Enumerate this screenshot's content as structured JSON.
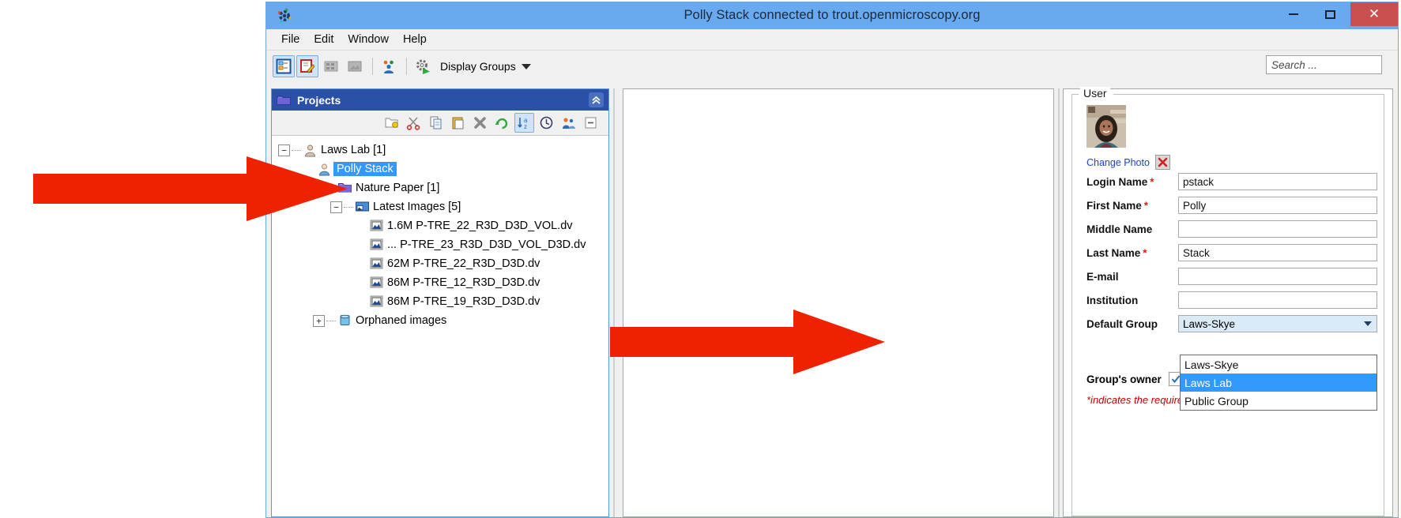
{
  "window": {
    "title": "Polly Stack connected to trout.openmicroscopy.org",
    "logo_icon": "omero-logo-icon",
    "controls": {
      "minimize": "–",
      "maximize": "□",
      "close": "✕",
      "close_color": "#c8514f"
    },
    "titlebar_color": "#69a9f0"
  },
  "menu": {
    "items": [
      {
        "label": "File"
      },
      {
        "label": "Edit"
      },
      {
        "label": "Window"
      },
      {
        "label": "Help"
      }
    ]
  },
  "toolbar": {
    "buttons": [
      {
        "name": "tree-view-button",
        "icon": "tree-view-icon",
        "active": true
      },
      {
        "name": "edit-metadata-button",
        "icon": "edit-pencil-icon",
        "active": true
      },
      {
        "name": "thumbnail-view-button",
        "icon": "grid-view-icon",
        "active": false
      },
      {
        "name": "image-view-button",
        "icon": "image-view-icon",
        "active": false
      },
      {
        "name": "groups-users-button",
        "icon": "people-icon",
        "active": false
      },
      {
        "name": "scripts-button",
        "icon": "gear-run-icon",
        "active": false
      }
    ],
    "display_groups_label": "Display Groups",
    "display_groups_caret": "caret-down-icon",
    "search": {
      "placeholder": "Search ...",
      "value": ""
    }
  },
  "left_panel": {
    "header": {
      "icon": "folder-icon",
      "title": "Projects",
      "collapse_icon": "chevron-double-up-icon"
    },
    "tree_toolbar": [
      {
        "name": "new-container-button",
        "icon": "new-folder-icon",
        "active": false
      },
      {
        "name": "cut-button",
        "icon": "scissors-icon",
        "active": false
      },
      {
        "name": "copy-button",
        "icon": "copy-icon",
        "active": false
      },
      {
        "name": "paste-button",
        "icon": "paste-icon",
        "active": false
      },
      {
        "name": "delete-button",
        "icon": "delete-x-icon",
        "active": false
      },
      {
        "name": "refresh-button",
        "icon": "refresh-icon",
        "active": false
      },
      {
        "name": "sort-az-button",
        "icon": "sort-alpha-icon",
        "active": true
      },
      {
        "name": "info-button",
        "icon": "clock-icon",
        "active": false
      },
      {
        "name": "users-button",
        "icon": "users-icon",
        "active": false
      },
      {
        "name": "collapse-all-button",
        "icon": "collapse-all-icon",
        "active": false
      }
    ],
    "tree": [
      {
        "label": "Laws Lab [1]",
        "icon": "user-group-icon",
        "indent": 0,
        "expander": "−",
        "selected": false
      },
      {
        "label": "Polly Stack",
        "icon": "user-icon",
        "indent": 1,
        "expander": "",
        "selected": true
      },
      {
        "label": "Nature Paper [1]",
        "icon": "project-folder-icon",
        "indent": 2,
        "expander": "−",
        "selected": false
      },
      {
        "label": "Latest Images [5]",
        "icon": "dataset-icon",
        "indent": 3,
        "expander": "−",
        "selected": false
      },
      {
        "label": "1.6M P-TRE_22_R3D_D3D_VOL.dv",
        "icon": "image-icon",
        "indent": 4,
        "expander": "",
        "selected": false
      },
      {
        "label": "... P-TRE_23_R3D_D3D_VOL_D3D.dv",
        "icon": "image-icon",
        "indent": 4,
        "expander": "",
        "selected": false
      },
      {
        "label": "62M P-TRE_22_R3D_D3D.dv",
        "icon": "image-icon",
        "indent": 4,
        "expander": "",
        "selected": false
      },
      {
        "label": "86M P-TRE_12_R3D_D3D.dv",
        "icon": "image-icon",
        "indent": 4,
        "expander": "",
        "selected": false
      },
      {
        "label": "86M P-TRE_19_R3D_D3D.dv",
        "icon": "image-icon",
        "indent": 4,
        "expander": "",
        "selected": false
      },
      {
        "label": "Orphaned images",
        "icon": "orphaned-icon",
        "indent": 2,
        "expander": "+",
        "selected": false
      }
    ],
    "selection_color": "#3399ff"
  },
  "right_panel": {
    "legend": "User",
    "avatar_icon": "user-photo",
    "change_photo_label": "Change Photo",
    "delete_photo_icon": "red-x-icon",
    "fields": [
      {
        "label": "Login Name",
        "required": true,
        "value": "pstack",
        "type": "text"
      },
      {
        "label": "First Name",
        "required": true,
        "value": "Polly",
        "type": "text"
      },
      {
        "label": "Middle Name",
        "required": false,
        "value": "",
        "type": "text"
      },
      {
        "label": "Last Name",
        "required": true,
        "value": "Stack",
        "type": "text"
      },
      {
        "label": "E-mail",
        "required": false,
        "value": "",
        "type": "text"
      },
      {
        "label": "Institution",
        "required": false,
        "value": "",
        "type": "text"
      },
      {
        "label": "Default Group",
        "required": false,
        "value": "Laws-Skye",
        "type": "combo"
      }
    ],
    "default_group": {
      "selected": "Laws-Skye",
      "expanded": true,
      "options": [
        {
          "label": "Laws-Skye",
          "highlighted": false
        },
        {
          "label": "Laws Lab",
          "highlighted": true
        },
        {
          "label": "Public Group",
          "highlighted": false
        }
      ]
    },
    "owner": {
      "label": "Group's owner",
      "checked": true,
      "check_glyph": "✓"
    },
    "required_note": "*indicates the required fields."
  },
  "annotations": {
    "arrow_color": "#ee2200",
    "arrows": [
      {
        "name": "arrow-to-polly-stack",
        "target": "Polly Stack"
      },
      {
        "name": "arrow-to-default-group",
        "target": "Default Group"
      }
    ]
  }
}
